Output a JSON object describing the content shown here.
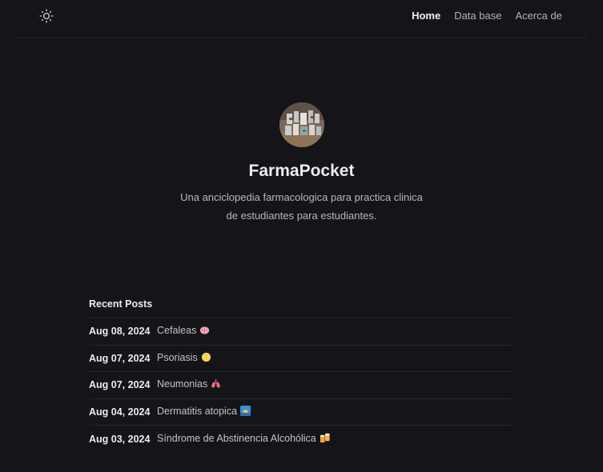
{
  "header": {
    "theme_toggle_icon": "sun-icon",
    "nav": [
      {
        "label": "Home",
        "active": true
      },
      {
        "label": "Data base",
        "active": false
      },
      {
        "label": "Acerca de",
        "active": false
      }
    ]
  },
  "profile": {
    "title": "FarmaPocket",
    "description": "Una anciclopedia farmacologica para practica clinica de estudiantes para estudiantes."
  },
  "recent_posts": {
    "heading": "Recent Posts",
    "items": [
      {
        "date": "Aug 08, 2024",
        "title": "Cefaleas",
        "icon": "brain-icon"
      },
      {
        "date": "Aug 07, 2024",
        "title": "Psoriasis",
        "icon": "circle-icon"
      },
      {
        "date": "Aug 07, 2024",
        "title": "Neumonias",
        "icon": "lungs-icon"
      },
      {
        "date": "Aug 04, 2024",
        "title": "Dermatitis atopica",
        "icon": "sunrise-icon"
      },
      {
        "date": "Aug 03, 2024",
        "title": "Síndrome de Abstinencia Alcohólica",
        "icon": "beer-icon"
      }
    ]
  },
  "colors": {
    "background": "#141419",
    "text": "#dadadb",
    "border": "#26262c"
  }
}
